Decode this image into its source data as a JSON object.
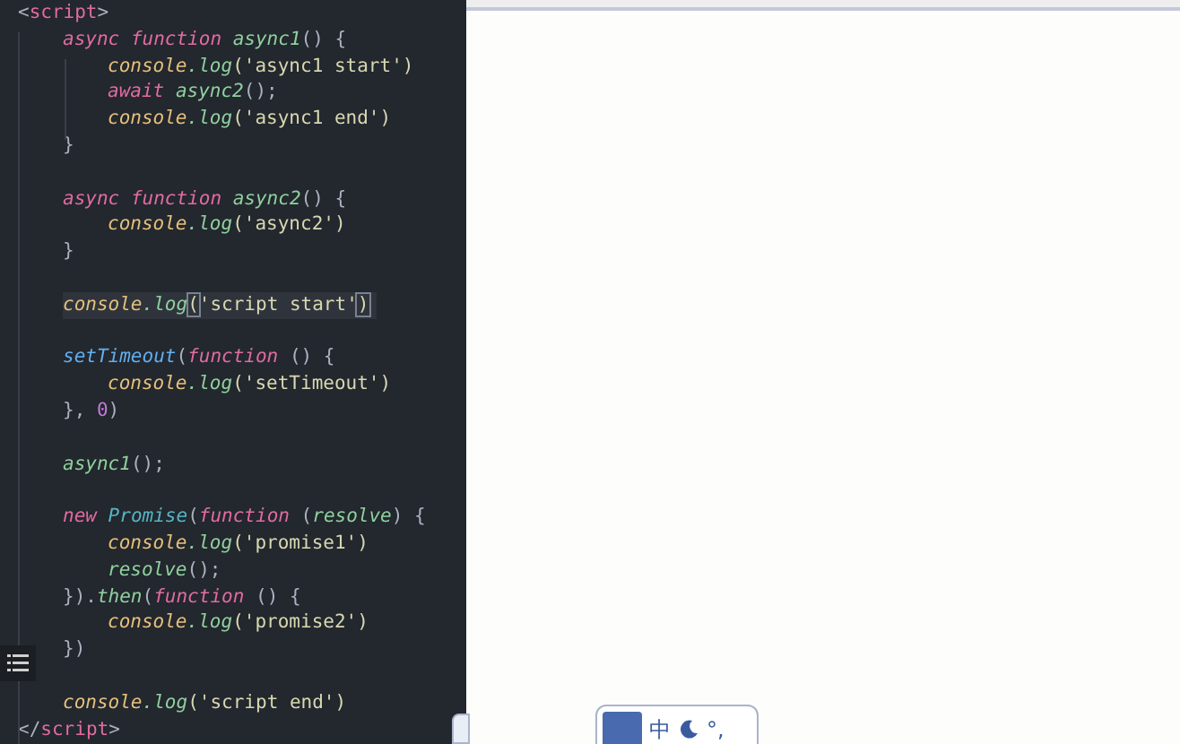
{
  "editor": {
    "lines": [
      {
        "kind": "top",
        "current": false,
        "tokens": [
          {
            "text": "<",
            "kind": "punct"
          },
          {
            "text": "script",
            "kind": "tag"
          },
          {
            "text": ">",
            "kind": "punct"
          }
        ]
      },
      {
        "kind": "one",
        "current": false,
        "tokens": [
          {
            "text": "async ",
            "kind": "keyword"
          },
          {
            "text": "function ",
            "kind": "keyword"
          },
          {
            "text": "async1",
            "kind": "fname"
          },
          {
            "text": "() {",
            "kind": "punct"
          }
        ]
      },
      {
        "kind": "two",
        "current": false,
        "tokens": [
          {
            "text": "console",
            "kind": "object"
          },
          {
            "text": ".log",
            "kind": "method"
          },
          {
            "text": "('async1 start')",
            "kind": "string"
          }
        ]
      },
      {
        "kind": "two",
        "current": false,
        "tokens": [
          {
            "text": "await ",
            "kind": "keyword"
          },
          {
            "text": "async2",
            "kind": "fname"
          },
          {
            "text": "();",
            "kind": "punct"
          }
        ]
      },
      {
        "kind": "two",
        "current": false,
        "tokens": [
          {
            "text": "console",
            "kind": "object"
          },
          {
            "text": ".log",
            "kind": "method"
          },
          {
            "text": "('async1 end')",
            "kind": "string"
          }
        ]
      },
      {
        "kind": "one",
        "current": false,
        "tokens": [
          {
            "text": "}",
            "kind": "punct"
          }
        ]
      },
      {
        "kind": "blank"
      },
      {
        "kind": "one",
        "current": false,
        "tokens": [
          {
            "text": "async ",
            "kind": "keyword"
          },
          {
            "text": "function ",
            "kind": "keyword"
          },
          {
            "text": "async2",
            "kind": "fname"
          },
          {
            "text": "() {",
            "kind": "punct"
          }
        ]
      },
      {
        "kind": "two",
        "current": false,
        "tokens": [
          {
            "text": "console",
            "kind": "object"
          },
          {
            "text": ".log",
            "kind": "method"
          },
          {
            "text": "('async2')",
            "kind": "string"
          }
        ]
      },
      {
        "kind": "one",
        "current": false,
        "tokens": [
          {
            "text": "}",
            "kind": "punct"
          }
        ]
      },
      {
        "kind": "blank"
      },
      {
        "kind": "one",
        "current": true,
        "tokens": [
          {
            "text": "console",
            "kind": "object"
          },
          {
            "text": ".log",
            "kind": "method"
          },
          {
            "text": "(",
            "kind": "bracket"
          },
          {
            "text": "'script start'",
            "kind": "string"
          },
          {
            "text": ")",
            "kind": "bracket"
          }
        ]
      },
      {
        "kind": "blank"
      },
      {
        "kind": "one",
        "current": false,
        "tokens": [
          {
            "text": "setTimeout",
            "kind": "call"
          },
          {
            "text": "(",
            "kind": "punct"
          },
          {
            "text": "function",
            "kind": "keyword"
          },
          {
            "text": " () {",
            "kind": "punct"
          }
        ]
      },
      {
        "kind": "two",
        "current": false,
        "tokens": [
          {
            "text": "console",
            "kind": "object"
          },
          {
            "text": ".log",
            "kind": "method"
          },
          {
            "text": "('setTimeout')",
            "kind": "string"
          }
        ]
      },
      {
        "kind": "one",
        "current": false,
        "tokens": [
          {
            "text": "}, ",
            "kind": "punct"
          },
          {
            "text": "0",
            "kind": "number"
          },
          {
            "text": ")",
            "kind": "punct"
          }
        ]
      },
      {
        "kind": "blank"
      },
      {
        "kind": "one",
        "current": false,
        "tokens": [
          {
            "text": "async1",
            "kind": "fname"
          },
          {
            "text": "();",
            "kind": "punct"
          }
        ]
      },
      {
        "kind": "blank"
      },
      {
        "kind": "one",
        "current": false,
        "tokens": [
          {
            "text": "new ",
            "kind": "keyword"
          },
          {
            "text": "Promise",
            "kind": "class"
          },
          {
            "text": "(",
            "kind": "punct"
          },
          {
            "text": "function",
            "kind": "keyword"
          },
          {
            "text": " (",
            "kind": "punct"
          },
          {
            "text": "resolve",
            "kind": "fname"
          },
          {
            "text": ") {",
            "kind": "punct"
          }
        ]
      },
      {
        "kind": "two",
        "current": false,
        "tokens": [
          {
            "text": "console",
            "kind": "object"
          },
          {
            "text": ".log",
            "kind": "method"
          },
          {
            "text": "('promise1')",
            "kind": "string"
          }
        ]
      },
      {
        "kind": "two",
        "current": false,
        "tokens": [
          {
            "text": "resolve",
            "kind": "fname"
          },
          {
            "text": "();",
            "kind": "punct"
          }
        ]
      },
      {
        "kind": "one",
        "current": false,
        "tokens": [
          {
            "text": "}).",
            "kind": "punct"
          },
          {
            "text": "then",
            "kind": "fname"
          },
          {
            "text": "(",
            "kind": "punct"
          },
          {
            "text": "function",
            "kind": "keyword"
          },
          {
            "text": " () {",
            "kind": "punct"
          }
        ]
      },
      {
        "kind": "two",
        "current": false,
        "tokens": [
          {
            "text": "console",
            "kind": "object"
          },
          {
            "text": ".log",
            "kind": "method"
          },
          {
            "text": "('promise2')",
            "kind": "string"
          }
        ]
      },
      {
        "kind": "one",
        "current": false,
        "tokens": [
          {
            "text": "})",
            "kind": "punct"
          }
        ]
      },
      {
        "kind": "blank"
      },
      {
        "kind": "one",
        "current": false,
        "tokens": [
          {
            "text": "console",
            "kind": "object"
          },
          {
            "text": ".log",
            "kind": "method"
          },
          {
            "text": "('script end')",
            "kind": "string"
          }
        ]
      },
      {
        "kind": "top",
        "current": false,
        "tokens": [
          {
            "text": "</",
            "kind": "punct"
          },
          {
            "text": "script",
            "kind": "tag"
          },
          {
            "text": ">",
            "kind": "punct"
          }
        ]
      }
    ]
  },
  "ime_toolbar": {
    "items": [
      {
        "text": "中",
        "kind": "text"
      },
      {
        "kind": "moon"
      },
      {
        "text": "°,",
        "kind": "text"
      }
    ]
  }
}
